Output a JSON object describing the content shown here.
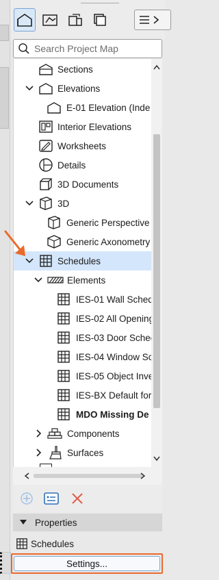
{
  "search": {
    "placeholder": "Search Project Map"
  },
  "toolbar": {
    "buttons": [
      {
        "icon": "project-map-icon",
        "active": true
      },
      {
        "icon": "view-map-icon"
      },
      {
        "icon": "layout-book-icon"
      },
      {
        "icon": "publisher-icon"
      }
    ],
    "menu_icon": "hamburger-icon"
  },
  "tree": {
    "items": [
      {
        "label": "Sections",
        "icon": "section-icon"
      },
      {
        "label": "Elevations",
        "icon": "elevation-icon",
        "expanded": true
      },
      {
        "label": "E-01 Elevation (Inde",
        "icon": "elevation-view-icon"
      },
      {
        "label": "Interior Elevations",
        "icon": "interior-elevation-icon"
      },
      {
        "label": "Worksheets",
        "icon": "worksheet-icon"
      },
      {
        "label": "Details",
        "icon": "detail-icon"
      },
      {
        "label": "3D Documents",
        "icon": "3d-document-icon"
      },
      {
        "label": "3D",
        "icon": "3d-icon",
        "expanded": true
      },
      {
        "label": "Generic Perspective",
        "icon": "perspective-icon"
      },
      {
        "label": "Generic Axonometry",
        "icon": "axonometry-icon"
      },
      {
        "label": "Schedules",
        "icon": "schedule-icon",
        "expanded": true,
        "selected": true
      },
      {
        "label": "Elements",
        "icon": "elements-hatch-icon",
        "expanded": true
      },
      {
        "label": "IES-01 Wall Sched",
        "icon": "schedule-icon"
      },
      {
        "label": "IES-02 All Opening",
        "icon": "schedule-icon"
      },
      {
        "label": "IES-03 Door Schec",
        "icon": "schedule-icon"
      },
      {
        "label": "IES-04 Window Sc",
        "icon": "schedule-icon"
      },
      {
        "label": "IES-05 Object Inve",
        "icon": "schedule-icon"
      },
      {
        "label": "IES-BX Default for",
        "icon": "schedule-icon"
      },
      {
        "label": "MDO Missing De",
        "icon": "schedule-icon",
        "bold": true
      },
      {
        "label": "Components",
        "icon": "components-icon",
        "expanded": false
      },
      {
        "label": "Surfaces",
        "icon": "surfaces-icon",
        "expanded": false
      }
    ]
  },
  "actions": {
    "add": "add-circle-icon",
    "settings": "view-settings-icon",
    "delete": "delete-x-icon"
  },
  "properties": {
    "header": "Properties",
    "item_label": "Schedules",
    "settings_button": "Settings..."
  },
  "colors": {
    "selection": "#d4e6fb",
    "highlight_border": "#ea6a2b",
    "annotation_arrow": "#ea6a2b",
    "delete_red": "#e35b4a",
    "add_blue": "#6e9fd8"
  }
}
